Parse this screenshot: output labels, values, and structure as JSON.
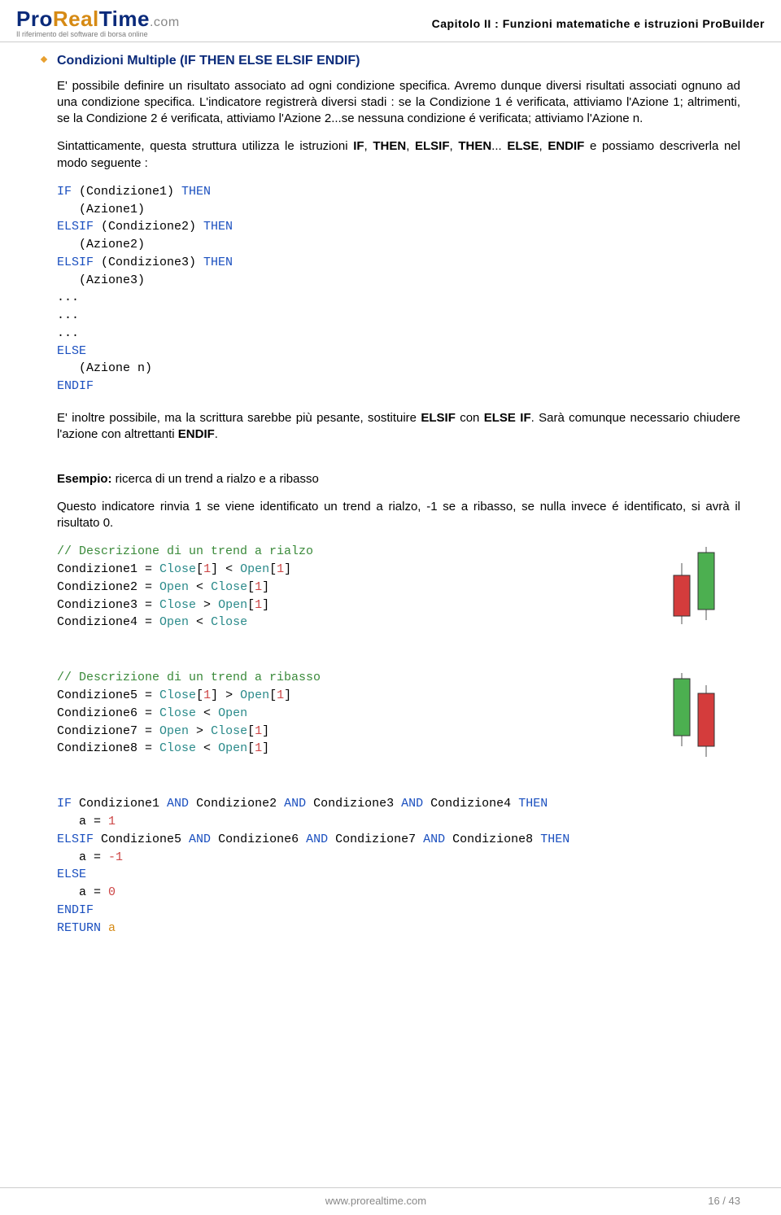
{
  "header": {
    "logo_pro": "Pro",
    "logo_real": "Real",
    "logo_time": "Time",
    "logo_com": ".com",
    "logo_tag": "Il riferimento del software di borsa online",
    "chapter": "Capitolo II : Funzioni matematiche e istruzioni ProBuilder"
  },
  "section": {
    "title": "Condizioni Multiple (IF THEN ELSE ELSIF ENDIF)",
    "p1_a": "E' possibile definire un risultato associato ad ogni condizione specifica. Avremo dunque diversi risultati associati ognuno ad una condizione specifica. L'indicatore registrerà diversi stadi : se la Condizione 1 é verificata, attiviamo l'Azione 1; altrimenti, se la Condizione 2 é verificata, attiviamo l'Azione 2...se nessuna condizione é verificata; attiviamo l'Azione n.",
    "p2_a": "Sintatticamente, questa struttura utilizza le istruzioni ",
    "p2_if": "IF",
    "p2_c1": ", ",
    "p2_then": "THEN",
    "p2_c2": ", ",
    "p2_elsif": "ELSIF",
    "p2_c3": ", ",
    "p2_then2": "THEN",
    "p2_c4": "... ",
    "p2_else": "ELSE",
    "p2_c5": ", ",
    "p2_endif": "ENDIF",
    "p2_b": " e possiamo descriverla nel modo seguente :",
    "code1": {
      "l1_a": "IF",
      "l1_b": " (Condizione1)",
      "l1_c": " THEN",
      "l2": "   (Azione1)",
      "l3_a": "ELSIF",
      "l3_b": " (Condizione2)",
      "l3_c": " THEN",
      "l4": "   (Azione2)",
      "l5_a": "ELSIF",
      "l5_b": " (Condizione3)",
      "l5_c": " THEN",
      "l6": "   (Azione3)",
      "l7": "...",
      "l8": "...",
      "l9": "...",
      "l10": "ELSE",
      "l11": "   (Azione n)",
      "l12": "ENDIF"
    },
    "p3_a": "E' inoltre possibile, ma la scrittura sarebbe più pesante, sostituire ",
    "p3_elsif": "ELSIF",
    "p3_b": " con ",
    "p3_elseif": "ELSE IF",
    "p3_c": ". Sarà comunque necessario chiudere l'azione con altrettanti ",
    "p3_endif": "ENDIF",
    "p3_d": ".",
    "example_label": "Esempio:",
    "example_desc": " ricerca di un trend a rialzo e a ribasso",
    "p4": "Questo indicatore rinvia 1 se viene identificato un trend a rialzo, -1 se a ribasso, se nulla invece é identificato, si avrà il risultato 0.",
    "code2": {
      "c": "// Descrizione di un trend a rialzo",
      "l1_a": "Condizione1 = ",
      "l1_b": "Close",
      "l1_c": "[",
      "l1_d": "1",
      "l1_e": "] < ",
      "l1_f": "Open",
      "l1_g": "[",
      "l1_h": "1",
      "l1_i": "]",
      "l2_a": "Condizione2 = ",
      "l2_b": "Open",
      "l2_c": " < ",
      "l2_d": "Close",
      "l2_e": "[",
      "l2_f": "1",
      "l2_g": "]",
      "l3_a": "Condizione3 = ",
      "l3_b": "Close",
      "l3_c": " > ",
      "l3_d": "Open",
      "l3_e": "[",
      "l3_f": "1",
      "l3_g": "]",
      "l4_a": "Condizione4 = ",
      "l4_b": "Open",
      "l4_c": " < ",
      "l4_d": "Close"
    },
    "code3": {
      "c": "// Descrizione di un trend a ribasso",
      "l1_a": "Condizione5 = ",
      "l1_b": "Close",
      "l1_c": "[",
      "l1_d": "1",
      "l1_e": "] > ",
      "l1_f": "Open",
      "l1_g": "[",
      "l1_h": "1",
      "l1_i": "]",
      "l2_a": "Condizione6 = ",
      "l2_b": "Close",
      "l2_c": " < ",
      "l2_d": "Open",
      "l3_a": "Condizione7 = ",
      "l3_b": "Open",
      "l3_c": " > ",
      "l3_d": "Close",
      "l3_e": "[",
      "l3_f": "1",
      "l3_g": "]",
      "l4_a": "Condizione8 = ",
      "l4_b": "Close",
      "l4_c": " < ",
      "l4_d": "Open",
      "l4_e": "[",
      "l4_f": "1",
      "l4_g": "]"
    },
    "code4": {
      "l1_a": "IF",
      "l1_b": " Condizione1 ",
      "l1_c": "AND",
      "l1_d": " Condizione2 ",
      "l1_e": "AND",
      "l1_f": " Condizione3 ",
      "l1_g": "AND",
      "l1_h": " Condizione4 ",
      "l1_i": "THEN",
      "l2_a": "   a = ",
      "l2_b": "1",
      "l3_a": "ELSIF",
      "l3_b": " Condizione5 ",
      "l3_c": "AND",
      "l3_d": " Condizione6 ",
      "l3_e": "AND",
      "l3_f": " Condizione7 ",
      "l3_g": "AND",
      "l3_h": " Condizione8 ",
      "l3_i": "THEN",
      "l4_a": "   a = ",
      "l4_b": "-1",
      "l5_a": "ELSE",
      "l6_a": "   a = ",
      "l6_b": "0",
      "l7": "ENDIF",
      "l8_a": "RETURN",
      "l8_b": " a"
    }
  },
  "footer": {
    "url": "www.prorealtime.com",
    "page": "16 / 43"
  }
}
